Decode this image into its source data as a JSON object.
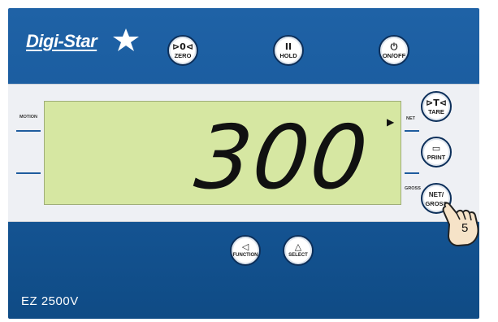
{
  "brand": {
    "name": "Digi-Star"
  },
  "top_buttons": [
    {
      "symbol": "⊳0⊲",
      "label": "ZERO"
    },
    {
      "symbol": "II",
      "label": "HOLD"
    },
    {
      "symbol": "⏻",
      "label": "ON/OFF"
    }
  ],
  "indicators": {
    "motion": "MOTION",
    "net": "NET",
    "gross": "GROSS"
  },
  "display": {
    "value": "300"
  },
  "side_buttons": [
    {
      "symbol": "⊳T⊲",
      "label": "TARE"
    },
    {
      "symbol": "▭",
      "label": "PRINT"
    },
    {
      "symbol": "NET/",
      "label": "GROSS"
    }
  ],
  "bottom_buttons": [
    {
      "symbol": "◁",
      "label": "FUNCTION"
    },
    {
      "symbol": "△",
      "label": "SELECT"
    }
  ],
  "step_badge": "5",
  "model": "EZ 2500V",
  "colors": {
    "body": "#185a9c",
    "lcd": "#d6e7a2",
    "panel": "#eef0f4"
  }
}
